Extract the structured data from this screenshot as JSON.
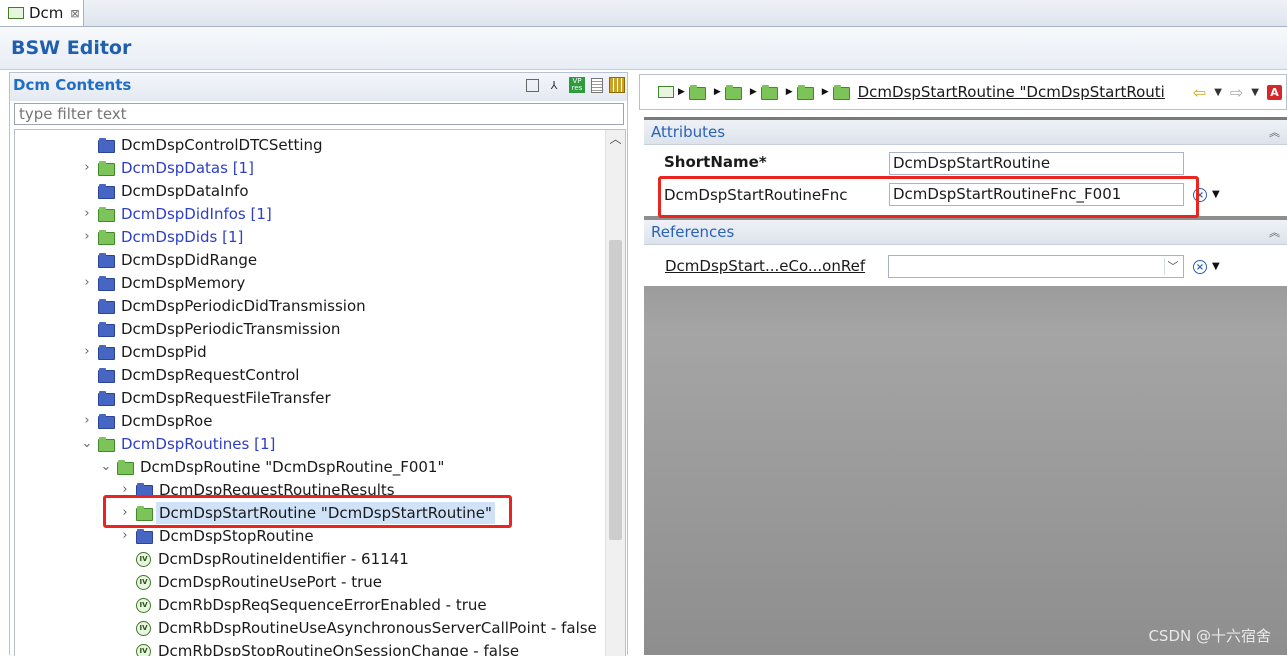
{
  "tab": {
    "label": "Dcm",
    "close": "⊠"
  },
  "editor": {
    "title": "BSW Editor"
  },
  "left": {
    "title": "Dcm Contents",
    "filter_placeholder": "type filter text",
    "tree": [
      {
        "label": "DcmDspControlDTCSetting",
        "icon": "folder-blue",
        "indent": 0,
        "twisty": "none",
        "linked": false
      },
      {
        "label": "DcmDspDatas [1]",
        "icon": "folder-green",
        "indent": 0,
        "twisty": "collapsed",
        "linked": true
      },
      {
        "label": "DcmDspDataInfo",
        "icon": "folder-blue",
        "indent": 0,
        "twisty": "none",
        "linked": false
      },
      {
        "label": "DcmDspDidInfos [1]",
        "icon": "folder-green",
        "indent": 0,
        "twisty": "collapsed",
        "linked": true
      },
      {
        "label": "DcmDspDids [1]",
        "icon": "folder-green",
        "indent": 0,
        "twisty": "collapsed",
        "linked": true
      },
      {
        "label": "DcmDspDidRange",
        "icon": "folder-blue",
        "indent": 0,
        "twisty": "none",
        "linked": false
      },
      {
        "label": "DcmDspMemory",
        "icon": "folder-blue",
        "indent": 0,
        "twisty": "collapsed",
        "linked": false
      },
      {
        "label": "DcmDspPeriodicDidTransmission",
        "icon": "folder-blue",
        "indent": 0,
        "twisty": "none",
        "linked": false
      },
      {
        "label": "DcmDspPeriodicTransmission",
        "icon": "folder-blue",
        "indent": 0,
        "twisty": "none",
        "linked": false
      },
      {
        "label": "DcmDspPid",
        "icon": "folder-blue",
        "indent": 0,
        "twisty": "collapsed",
        "linked": false
      },
      {
        "label": "DcmDspRequestControl",
        "icon": "folder-blue",
        "indent": 0,
        "twisty": "none",
        "linked": false
      },
      {
        "label": "DcmDspRequestFileTransfer",
        "icon": "folder-blue",
        "indent": 0,
        "twisty": "none",
        "linked": false
      },
      {
        "label": "DcmDspRoe",
        "icon": "folder-blue",
        "indent": 0,
        "twisty": "collapsed",
        "linked": false
      },
      {
        "label": "DcmDspRoutines [1]",
        "icon": "folder-green",
        "indent": 0,
        "twisty": "expanded",
        "linked": true
      },
      {
        "label": "DcmDspRoutine \"DcmDspRoutine_F001\"",
        "icon": "folder-green",
        "indent": 1,
        "twisty": "expanded",
        "linked": false
      },
      {
        "label": "DcmDspRequestRoutineResults",
        "icon": "folder-blue",
        "indent": 2,
        "twisty": "collapsed",
        "linked": false
      },
      {
        "label": "DcmDspStartRoutine \"DcmDspStartRoutine\"",
        "icon": "folder-green",
        "indent": 2,
        "twisty": "collapsed",
        "linked": false,
        "selected": true
      },
      {
        "label": "DcmDspStopRoutine",
        "icon": "folder-blue",
        "indent": 2,
        "twisty": "collapsed",
        "linked": false
      },
      {
        "label": "DcmDspRoutineIdentifier - 61141",
        "icon": "param",
        "indent": 2,
        "twisty": "none",
        "linked": false
      },
      {
        "label": "DcmDspRoutineUsePort - true",
        "icon": "param",
        "indent": 2,
        "twisty": "none",
        "linked": false
      },
      {
        "label": "DcmRbDspReqSequenceErrorEnabled - true",
        "icon": "param",
        "indent": 2,
        "twisty": "none",
        "linked": false
      },
      {
        "label": "DcmRbDspRoutineUseAsynchronousServerCallPoint - false",
        "icon": "param",
        "indent": 2,
        "twisty": "none",
        "linked": false
      },
      {
        "label": "DcmRbDspStopRoutineOnSessionChange - false",
        "icon": "param",
        "indent": 2,
        "twisty": "none",
        "linked": false
      }
    ]
  },
  "right": {
    "breadcrumb": {
      "current": "DcmDspStartRoutine \"DcmDspStartRouti"
    },
    "attributes": {
      "title": "Attributes",
      "shortname_label": "ShortName*",
      "shortname_value": "DcmDspStartRoutine",
      "fnc_label": "DcmDspStartRoutineFnc",
      "fnc_value": "DcmDspStartRoutineFnc_F001"
    },
    "references": {
      "title": "References",
      "ref_label": "DcmDspStart...eCo...onRef",
      "ref_value": ""
    }
  },
  "watermark": "CSDN @十六宿舍",
  "colors": {
    "accent": "#1f5fad",
    "highlight_box": "#e8251f",
    "link_blue": "#2d3ec7"
  }
}
